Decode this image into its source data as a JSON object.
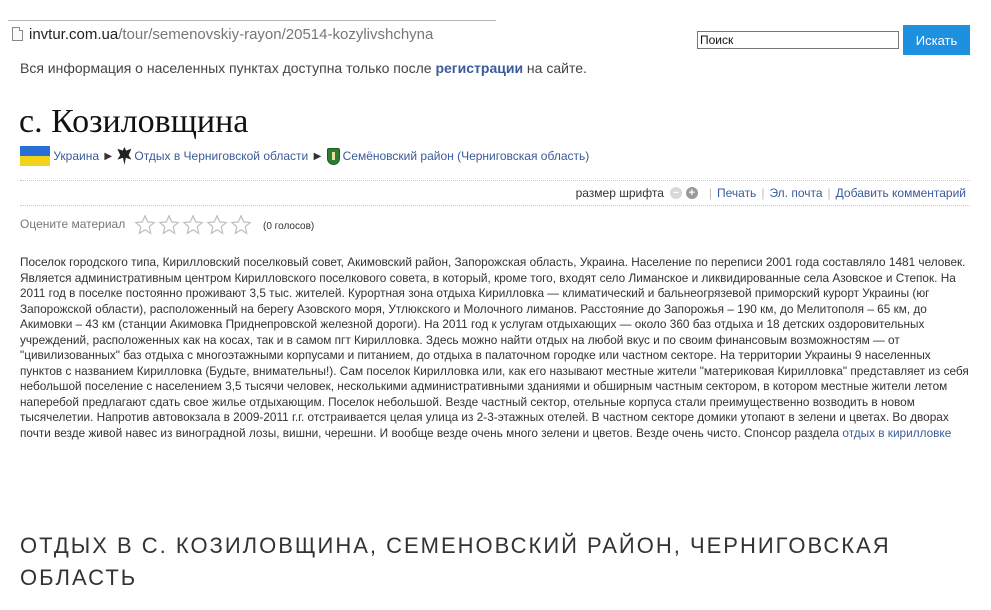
{
  "url_bar": {
    "host": "invtur.com.ua",
    "path": "/tour/semenovskiy-rayon/20514-kozylivshchyna"
  },
  "search": {
    "value": "Поиск",
    "button_label": "Искать"
  },
  "notice": {
    "before": "Вся информация о населенных пунктах доступна только после ",
    "link": "регистрации",
    "after": " на сайте."
  },
  "page_title": "с. Козиловщина",
  "breadcrumb": {
    "items": [
      "Украина",
      "Отдых в Черниговской области",
      "Семёновский район (Черниговская область)"
    ],
    "separator": "▶",
    "flag_colors": [
      "#2a6fd6",
      "#f3d31a"
    ]
  },
  "tools": {
    "font_size_label": "размер шрифта",
    "minus": "−",
    "plus": "+",
    "print": "Печать",
    "email": "Эл. почта",
    "add_comment": "Добавить комментарий",
    "separator": "|"
  },
  "rating": {
    "label": "Оцените материал",
    "stars_total": 5,
    "stars_filled": 0,
    "votes": "(0 голосов)"
  },
  "article": {
    "text": "Поселок городского типа, Кирилловский поселковый совет, Акимовский район, Запорожская область, Украина. Население по переписи 2001 года составляло 1481 человек. Является административным центром Кирилловского поселкового совета, в который, кроме того, входят село Лиманское и ликвидированные села Азовское и Степок. На 2011 год в поселке постоянно проживают 3,5 тыс. жителей. Курортная зона отдыха Кирилловка — климатический и бальнеогрязевой приморский курорт Украины (юг Запорожской области), расположенный на берегу Азовского моря, Утлюкского и Молочного лиманов. Расстояние до Запорожья – 190 км, до Мелитополя – 65 км, до Акимовки – 43 км (станции Акимовка Приднепровской железной дороги). На 2011 год к услугам отдыхающих — около 360 баз отдыха и 18 детских оздоровительных учреждений, расположенных как на косах, так и в самом пгт Кирилловка. Здесь можно найти отдых на любой вкус и по своим финансовым возможностям — от \"цивилизованных\" баз отдыха с многоэтажными корпусами и питанием, до отдыха в палаточном городке или частном секторе. На территории Украины 9 населенных пунктов с названием Кирилловка (Будьте, внимательны!). Сам поселок Кирилловка или, как его называют местные жители \"материковая Кирилловка\" представляет из себя небольшой поселение с населением 3,5 тысячи человек, несколькими административными зданиями и обширным частным сектором, в котором местные жители летом наперебой предлагают сдать свое жилье отдыхающим. Поселок небольшой. Везде частный сектор, отельные корпуса стали преимущественно возводить в новом тысячелетии. Напротив автовокзала в 2009-2011 г.г. отстраивается целая улица из 2-3-этажных отелей. В частном секторе домики утопают в зелени и цветах. Во дворах почти везде живой навес из виноградной лозы, вишни, черешни. И вообще везде очень много зелени и цветов. Везде очень чисто. Спонсор раздела ",
    "sponsor_link": "отдых в кирилловке"
  },
  "section_heading": "Отдых в с. Козиловщина, Семеновский район, Черниговская область",
  "colors": {
    "link": "#3a5a9a",
    "search_button": "#1e90e0"
  }
}
